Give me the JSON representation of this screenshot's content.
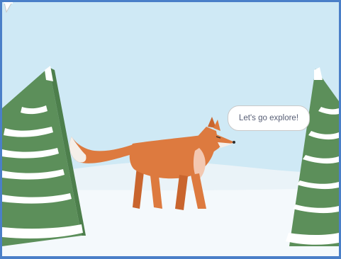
{
  "stage": {
    "background": "winter-snow-scene",
    "sky_color": "#cfe9f5",
    "snow_color": "#f3f8fb",
    "border_color": "#4a7fc8"
  },
  "sprite": {
    "name": "Fox",
    "speech": "Let's go explore!"
  },
  "icons": {
    "left_tree": "pine-tree-icon",
    "right_tree": "pine-tree-icon",
    "fox": "fox-icon"
  }
}
